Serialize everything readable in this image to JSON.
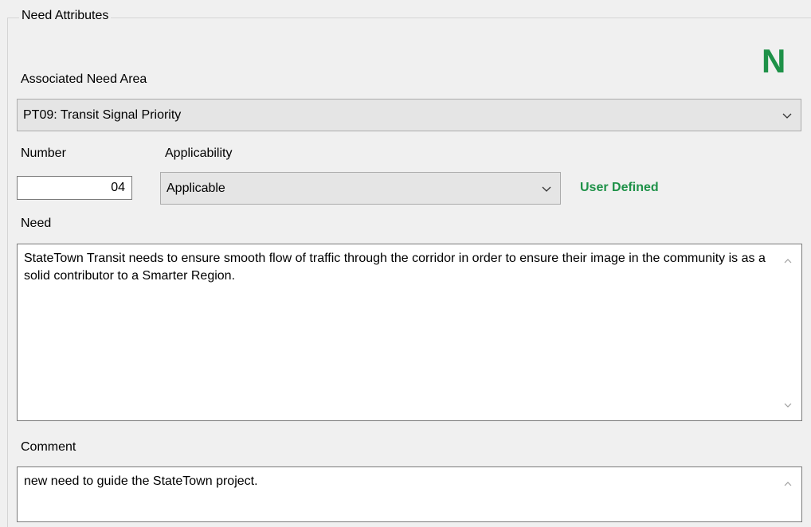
{
  "group": {
    "title": "Need Attributes",
    "badge": "N"
  },
  "need_area": {
    "label": "Associated Need Area",
    "value": "PT09: Transit Signal Priority"
  },
  "number": {
    "label": "Number",
    "value": "04"
  },
  "applicability": {
    "label": "Applicability",
    "value": "Applicable"
  },
  "status_text": "User Defined",
  "need": {
    "label": "Need",
    "text": "StateTown Transit needs to ensure smooth flow of traffic through the corridor in order to ensure their image in the community is as a solid contributor to a Smarter Region."
  },
  "comment": {
    "label": "Comment",
    "text": "new need to guide the StateTown project."
  },
  "colors": {
    "accent_green": "#1e9148",
    "panel_bg": "#f0f0f0",
    "combo_bg": "#e5e5e5"
  },
  "icons": [
    "chevron-down-icon",
    "scroll-up-icon",
    "scroll-down-icon"
  ]
}
